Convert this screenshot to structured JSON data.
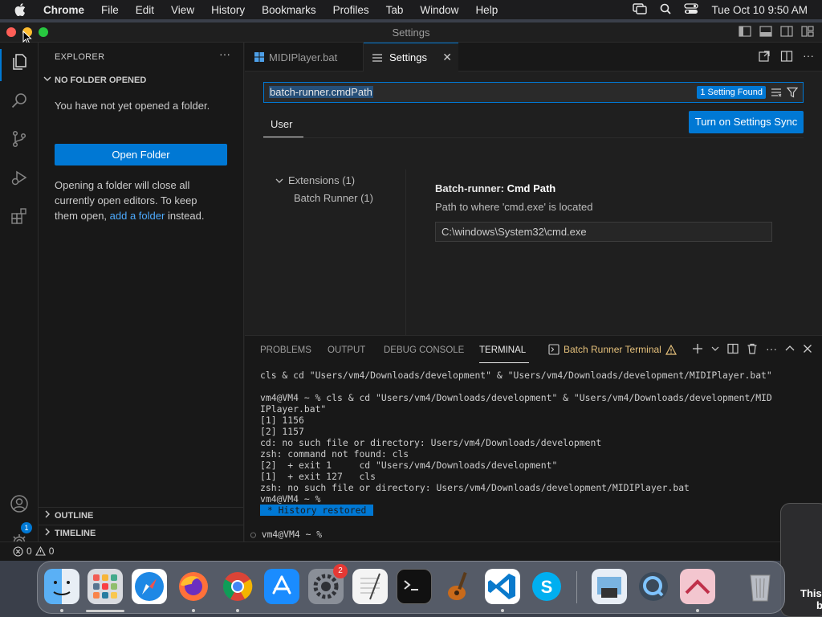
{
  "menubar": {
    "app": "Chrome",
    "items": [
      "File",
      "Edit",
      "View",
      "History",
      "Bookmarks",
      "Profiles",
      "Tab",
      "Window",
      "Help"
    ],
    "datetime": "Tue Oct 10  9:50 AM"
  },
  "window": {
    "title": "Settings"
  },
  "sidebar": {
    "header": "EXPLORER",
    "section_title": "NO FOLDER OPENED",
    "message": "You have not yet opened a folder.",
    "open_folder_label": "Open Folder",
    "info_before": "Opening a folder will close all currently open editors. To keep them open, ",
    "info_link": "add a folder",
    "info_after": " instead.",
    "outline_label": "OUTLINE",
    "timeline_label": "TIMELINE"
  },
  "activity": {
    "settings_badge": "1"
  },
  "tabs": [
    {
      "label": "MIDIPlayer.bat",
      "icon": "windows-icon",
      "active": false
    },
    {
      "label": "Settings",
      "icon": "settings-lines-icon",
      "active": true
    }
  ],
  "settings": {
    "search_value": "batch-runner.cmdPath",
    "results_badge": "1 Setting Found",
    "scope_tab": "User",
    "sync_button": "Turn on Settings Sync",
    "toc_extensions": "Extensions (1)",
    "toc_batch_runner": "Batch Runner (1)",
    "setting_category": "Batch-runner: ",
    "setting_name": "Cmd Path",
    "setting_description": "Path to where 'cmd.exe' is located",
    "setting_value": "C:\\windows\\System32\\cmd.exe"
  },
  "panel": {
    "tabs": [
      "PROBLEMS",
      "OUTPUT",
      "DEBUG CONSOLE",
      "TERMINAL"
    ],
    "active_tab": "TERMINAL",
    "terminal_name": "Batch Runner Terminal",
    "terminal_lines": [
      "cls & cd \"Users/vm4/Downloads/development\" & \"Users/vm4/Downloads/development/MIDIPlayer.bat\"",
      "",
      "vm4@VM4 ~ % cls & cd \"Users/vm4/Downloads/development\" & \"Users/vm4/Downloads/development/MID",
      "IPlayer.bat\"",
      "[1] 1156",
      "[2] 1157",
      "cd: no such file or directory: Users/vm4/Downloads/development",
      "zsh: command not found: cls",
      "[2]  + exit 1     cd \"Users/vm4/Downloads/development\"",
      "[1]  + exit 127   cls",
      "zsh: no such file or directory: Users/vm4/Downloads/development/MIDIPlayer.bat",
      "vm4@VM4 ~ %"
    ],
    "history_restored": " * History restored ",
    "current_prompt": "vm4@VM4 ~ %"
  },
  "statusbar": {
    "errors": "0",
    "warnings": "0"
  },
  "dock": {
    "apps": [
      "finder",
      "launchpad",
      "safari",
      "firefox",
      "chrome",
      "app-store",
      "system-settings",
      "textedit",
      "terminal",
      "garageband",
      "vscode",
      "skype",
      "preview",
      "quicktime",
      "pixelmator",
      "trash"
    ],
    "system_settings_badge": "2"
  },
  "notification": {
    "text_line1": "This",
    "text_line2": "b"
  },
  "colors": {
    "accent": "#0078d4",
    "editor_bg": "#1f1f1f",
    "sidebar_bg": "#181818",
    "warning": "#e5c07b"
  }
}
